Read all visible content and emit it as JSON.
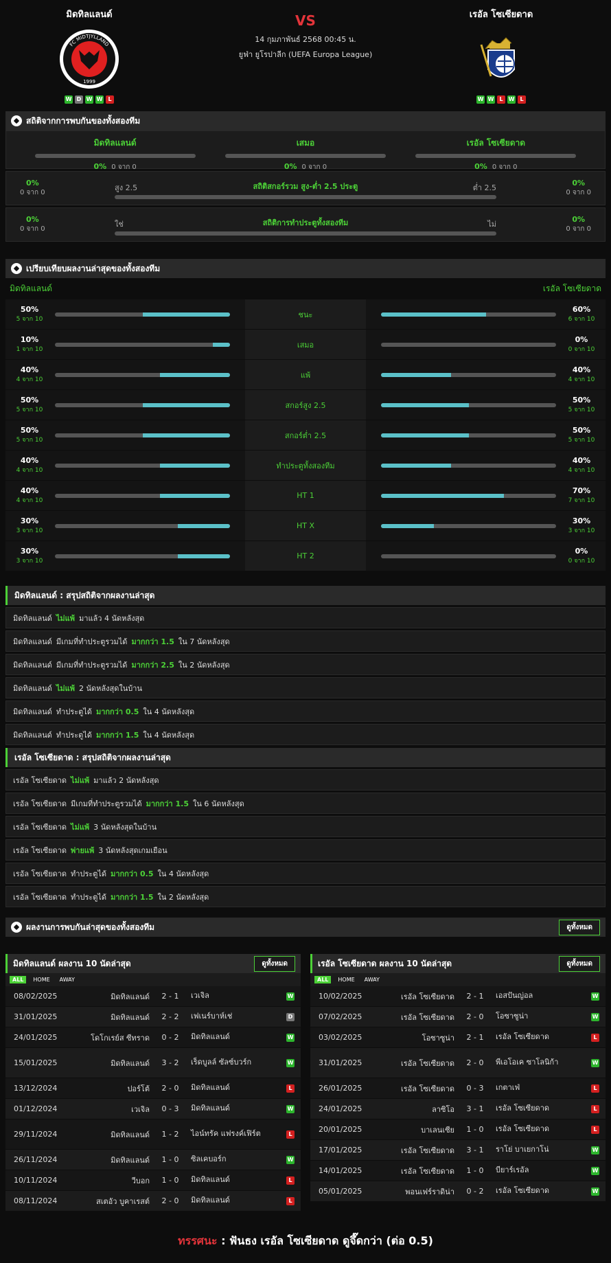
{
  "match": {
    "home": "มิดทิลแลนด์",
    "away": "เรอัล โซเซียดาด",
    "vs": "VS",
    "date": "14 กุมภาพันธ์ 2568 00:45 น.",
    "league": "ยูฟ่า ยูโรปาลีก (UEFA Europa League)",
    "home_form": [
      "W",
      "D",
      "W",
      "W",
      "L"
    ],
    "away_form": [
      "W",
      "W",
      "L",
      "W",
      "L"
    ],
    "home_logo_text": "FC MIDTJYLLAND",
    "home_logo_year": "1999"
  },
  "h2h": {
    "title": "สถิติจากการพบกันของทั้งสองทีม",
    "cols": [
      {
        "label": "มิดทิลแลนด์",
        "pct": "0%",
        "count": "0 จาก 0"
      },
      {
        "label": "เสมอ",
        "pct": "0%",
        "count": "0 จาก 0"
      },
      {
        "label": "เรอัล โซเซียดาด",
        "pct": "0%",
        "count": "0 จาก 0"
      }
    ],
    "ou": {
      "title": "สถิติสกอร์รวม สูง-ต่ำ 2.5 ประตู",
      "left_pct": "0%",
      "left_count": "0 จาก 0",
      "right_pct": "0%",
      "right_count": "0 จาก 0",
      "left_sub": "สูง 2.5",
      "right_sub": "ต่ำ 2.5"
    },
    "btts": {
      "title": "สถิติการทำประตูทั้งสองทีม",
      "left_pct": "0%",
      "left_count": "0 จาก 0",
      "right_pct": "0%",
      "right_count": "0 จาก 0",
      "left_sub": "ใช่",
      "right_sub": "ไม่"
    }
  },
  "compare": {
    "title": "เปรียบเทียบผลงานล่าสุดของทั้งสองทีม",
    "home": "มิดทิลแลนด์",
    "away": "เรอัล โซเซียดาด",
    "rows": [
      {
        "label": "ชนะ",
        "h_pct": "50%",
        "h_sub": "5 จาก 10",
        "h_val": 0.5,
        "a_pct": "60%",
        "a_sub": "6 จาก 10",
        "a_val": 0.6
      },
      {
        "label": "เสมอ",
        "h_pct": "10%",
        "h_sub": "1 จาก 10",
        "h_val": 0.1,
        "a_pct": "0%",
        "a_sub": "0 จาก 10",
        "a_val": 0
      },
      {
        "label": "แพ้",
        "h_pct": "40%",
        "h_sub": "4 จาก 10",
        "h_val": 0.4,
        "a_pct": "40%",
        "a_sub": "4 จาก 10",
        "a_val": 0.4
      },
      {
        "label": "สกอร์สูง 2.5",
        "h_pct": "50%",
        "h_sub": "5 จาก 10",
        "h_val": 0.5,
        "a_pct": "50%",
        "a_sub": "5 จาก 10",
        "a_val": 0.5
      },
      {
        "label": "สกอร์ต่ำ 2.5",
        "h_pct": "50%",
        "h_sub": "5 จาก 10",
        "h_val": 0.5,
        "a_pct": "50%",
        "a_sub": "5 จาก 10",
        "a_val": 0.5
      },
      {
        "label": "ทำประตูทั้งสองทีม",
        "h_pct": "40%",
        "h_sub": "4 จาก 10",
        "h_val": 0.4,
        "a_pct": "40%",
        "a_sub": "4 จาก 10",
        "a_val": 0.4
      },
      {
        "label": "HT 1",
        "h_pct": "40%",
        "h_sub": "4 จาก 10",
        "h_val": 0.4,
        "a_pct": "70%",
        "a_sub": "7 จาก 10",
        "a_val": 0.7
      },
      {
        "label": "HT X",
        "h_pct": "30%",
        "h_sub": "3 จาก 10",
        "h_val": 0.3,
        "a_pct": "30%",
        "a_sub": "3 จาก 10",
        "a_val": 0.3
      },
      {
        "label": "HT 2",
        "h_pct": "30%",
        "h_sub": "3 จาก 10",
        "h_val": 0.3,
        "a_pct": "0%",
        "a_sub": "0 จาก 10",
        "a_val": 0
      }
    ]
  },
  "home_summary": {
    "title": "มิดทิลแลนด์ : สรุปสถิติจากผลงานล่าสุด",
    "rows": [
      [
        "มิดทิลแลนด์",
        "ไม่แพ้",
        "มาแล้ว 4 นัดหลังสุด"
      ],
      [
        "มิดทิลแลนด์",
        "มีเกมที่ทำประตูรวมได้",
        "มากกว่า 1.5",
        "ใน 7 นัดหลังสุด"
      ],
      [
        "มิดทิลแลนด์",
        "มีเกมที่ทำประตูรวมได้",
        "มากกว่า 2.5",
        "ใน 2 นัดหลังสุด"
      ],
      [
        "มิดทิลแลนด์",
        "ไม่แพ้",
        "2 นัดหลังสุดในบ้าน"
      ],
      [
        "มิดทิลแลนด์",
        "ทำประตูได้",
        "มากกว่า 0.5",
        "ใน 4 นัดหลังสุด"
      ],
      [
        "มิดทิลแลนด์",
        "ทำประตูได้",
        "มากกว่า 1.5",
        "ใน 4 นัดหลังสุด"
      ]
    ]
  },
  "away_summary": {
    "title": "เรอัล โซเซียดาด : สรุปสถิติจากผลงานล่าสุด",
    "rows": [
      [
        "เรอัล โซเซียดาด",
        "ไม่แพ้",
        "มาแล้ว 2 นัดหลังสุด"
      ],
      [
        "เรอัล โซเซียดาด",
        "มีเกมที่ทำประตูรวมได้",
        "มากกว่า 1.5",
        "ใน 6 นัดหลังสุด"
      ],
      [
        "เรอัล โซเซียดาด",
        "ไม่แพ้",
        "3 นัดหลังสุดในบ้าน"
      ],
      [
        "เรอัล โซเซียดาด",
        "พ่ายแพ้",
        "3 นัดหลังสุดเกมเยือน"
      ],
      [
        "เรอัล โซเซียดาด",
        "ทำประตูได้",
        "มากกว่า 0.5",
        "ใน 4 นัดหลังสุด"
      ],
      [
        "เรอัล โซเซียดาด",
        "ทำประตูได้",
        "มากกว่า 1.5",
        "ใน 2 นัดหลังสุด"
      ]
    ]
  },
  "recent": {
    "title": "ผลงานการพบกันล่าสุดของทั้งสองทีม",
    "see_all": "ดูทั้งหมด",
    "tabs": [
      "ALL",
      "HOME",
      "AWAY"
    ],
    "home_title": "มิดทิลแลนด์ ผลงาน 10 นัดล่าสุด",
    "away_title": "เรอัล โซเซียดาด ผลงาน 10 นัดล่าสุด",
    "home_matches": [
      [
        "08/02/2025",
        "มิดทิลแลนด์",
        "2 - 1",
        "เวเจิล",
        "W"
      ],
      [
        "31/01/2025",
        "มิดทิลแลนด์",
        "2 - 2",
        "เฟเนร์บาห์เช่",
        "D"
      ],
      [
        "24/01/2025",
        "โดโกเรย์ส ซีทราด",
        "0 - 2",
        "มิดทิลแลนด์",
        "W"
      ],
      [
        "15/01/2025",
        "มิดทิลแลนด์",
        "3 - 2",
        "เร็ดบูลล์ ซัลซ์บวร์ก",
        "W"
      ],
      [
        "13/12/2024",
        "ปอร์โต้",
        "2 - 0",
        "มิดทิลแลนด์",
        "L"
      ],
      [
        "01/12/2024",
        "เวเจิล",
        "0 - 3",
        "มิดทิลแลนด์",
        "W"
      ],
      [
        "29/11/2024",
        "มิดทิลแลนด์",
        "1 - 2",
        "ไอน์ทรัค แฟรงค์เฟิร์ต",
        "L"
      ],
      [
        "26/11/2024",
        "มิดทิลแลนด์",
        "1 - 0",
        "ซิลเคบอร์ก",
        "W"
      ],
      [
        "10/11/2024",
        "วีบอก",
        "1 - 0",
        "มิดทิลแลนด์",
        "L"
      ],
      [
        "08/11/2024",
        "สเตอัว บูคาเรสต์",
        "2 - 0",
        "มิดทิลแลนด์",
        "L"
      ]
    ],
    "away_matches": [
      [
        "10/02/2025",
        "เรอัล โซเซียดาด",
        "2 - 1",
        "เอสปันญ่อล",
        "W"
      ],
      [
        "07/02/2025",
        "เรอัล โซเซียดาด",
        "2 - 0",
        "โอซาซูน่า",
        "W"
      ],
      [
        "03/02/2025",
        "โอซาซูน่า",
        "2 - 1",
        "เรอัล โซเซียดาด",
        "L"
      ],
      [
        "31/01/2025",
        "เรอัล โซเซียดาด",
        "2 - 0",
        "พีเอโอเค ซาโลนิก้า",
        "W"
      ],
      [
        "26/01/2025",
        "เรอัล โซเซียดาด",
        "0 - 3",
        "เกตาเฟ่",
        "L"
      ],
      [
        "24/01/2025",
        "ลาซิโอ",
        "3 - 1",
        "เรอัล โซเซียดาด",
        "L"
      ],
      [
        "20/01/2025",
        "บาเลนเซีย",
        "1 - 0",
        "เรอัล โซเซียดาด",
        "L"
      ],
      [
        "17/01/2025",
        "เรอัล โซเซียดาด",
        "3 - 1",
        "ราโย่ บาเยกาโน่",
        "W"
      ],
      [
        "14/01/2025",
        "เรอัล โซเซียดาด",
        "1 - 0",
        "บียาร์เรอัล",
        "W"
      ],
      [
        "05/01/2025",
        "พอนเฟร์ราดิน่า",
        "0 - 2",
        "เรอัล โซเซียดาด",
        "W"
      ]
    ]
  },
  "verdict": {
    "label": "ทรรศนะ",
    "sep": ":",
    "text": "ฟันธง เรอัล โซเซียดาด ดูจึ๊ดกว่า (ต่อ 0.5)"
  },
  "colors": {
    "accent": "#4cd137",
    "bar": "#5bc0c8",
    "vs": "#e3343a"
  }
}
